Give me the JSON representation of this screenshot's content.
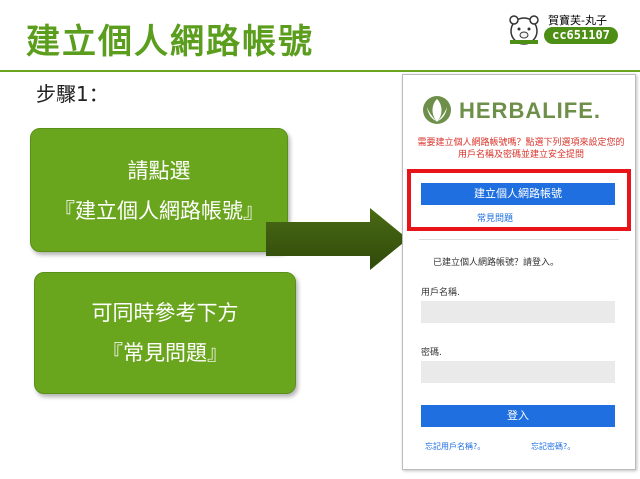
{
  "slide": {
    "title": "建立個人網路帳號",
    "step": "步驟1：",
    "badge": {
      "name": "賀寶芙-丸子",
      "id": "cc651107"
    },
    "box1": {
      "line1": "請點選",
      "line2": "『建立個人網路帳號』"
    },
    "box2": {
      "line1": "可同時參考下方",
      "line2": "『常見問題』"
    },
    "colors": {
      "green": "#6aa51e",
      "red": "#e8141a",
      "blue": "#1f6fe0"
    }
  },
  "herbalife": {
    "logo": "HERBALIFE.",
    "notice": "需要建立個人網路帳號嗎？點選下列選項來設定您的用戶名稱及密碼並建立安全提問",
    "create_button": "建立個人網路帳號",
    "faq_link": "常見問題",
    "have_account": "已建立個人網路帳號？請登入。",
    "username_label": "用戶名稱.",
    "password_label": "密碼.",
    "login_button": "登入",
    "forgot_username": "忘記用戶名稱?。",
    "forgot_password": "忘記密碼?。"
  }
}
